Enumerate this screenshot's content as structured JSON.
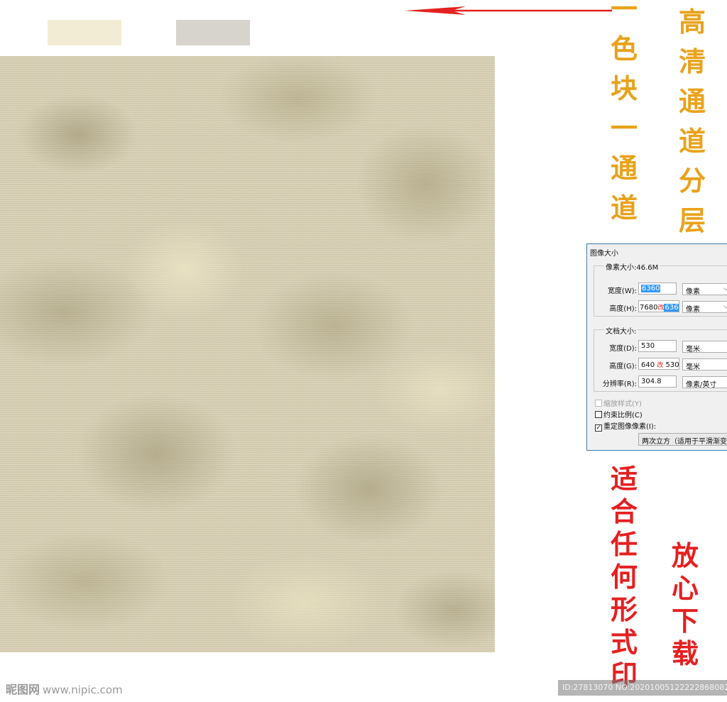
{
  "swatches": [
    {
      "color": "#f3ecd4"
    },
    {
      "color": "#d6d4cd"
    }
  ],
  "annotations": {
    "color_block_channel": [
      "一",
      "色",
      "块",
      "一",
      "通",
      "道"
    ],
    "hd_channel_layers": [
      "高",
      "清",
      "通",
      "道",
      "分",
      "层"
    ],
    "fit_any_print": [
      "适",
      "合",
      "任",
      "何",
      "形",
      "式",
      "印"
    ],
    "download_safe": [
      "放",
      "心",
      "下",
      "载"
    ],
    "arrow_color": "#e52020",
    "gold_color": "#e9a21b",
    "red_color": "#e52020"
  },
  "dialog": {
    "title": "图像大小",
    "pixel_dimensions_label": "像素大小:46.6M",
    "width_label": "宽度(W):",
    "width_value": "6360",
    "width_unit": "像素",
    "height_label": "高度(H):",
    "height_value_old": "7680",
    "height_value_mark": "改",
    "height_value_new": "6360",
    "height_unit": "像素",
    "document_size_label": "文档大小:",
    "doc_width_label": "宽度(D):",
    "doc_width_value": "530",
    "doc_width_unit": "毫米",
    "doc_height_label": "高度(G):",
    "doc_height_value_old": "640",
    "doc_height_value_mark": "改",
    "doc_height_value_new": "530",
    "doc_height_unit": "毫米",
    "resolution_label": "分辨率(R):",
    "resolution_value": "304.8",
    "resolution_unit": "像素/英寸",
    "scale_styles_label": "缩放样式(Y)",
    "constrain_label": "约束比例(C)",
    "resample_label": "重定图像像素(I):",
    "resample_value": "两次立方（适用于平滑渐变"
  },
  "footer": {
    "site_name": "昵图网",
    "site_url": "www.nipic.com",
    "id_text": "ID:27813070 NO:20201005122222868082"
  }
}
